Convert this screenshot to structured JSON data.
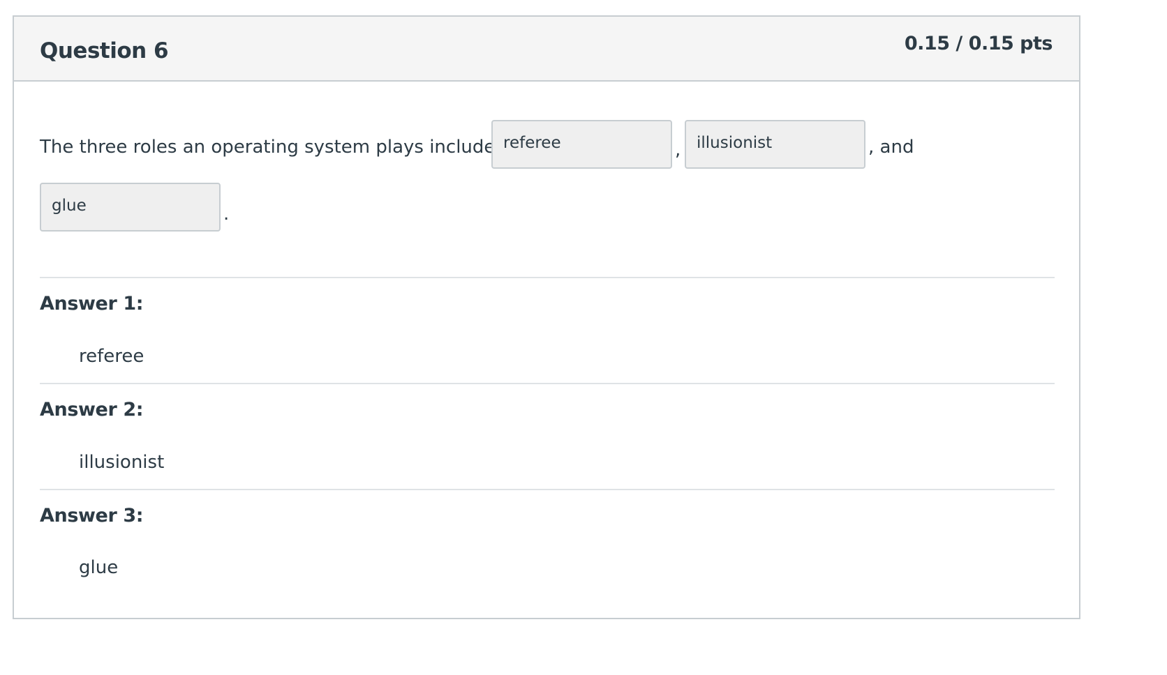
{
  "question": {
    "title": "Question 6",
    "points": "0.15 / 0.15 pts",
    "text_before": "The three roles an operating system plays include",
    "separator_1": ",",
    "separator_2": ", and",
    "text_end": ".",
    "blanks": [
      "referee",
      "illusionist",
      "glue"
    ]
  },
  "answers": [
    {
      "label": "Answer 1:",
      "value": "referee"
    },
    {
      "label": "Answer 2:",
      "value": "illusionist"
    },
    {
      "label": "Answer 3:",
      "value": "glue"
    }
  ]
}
